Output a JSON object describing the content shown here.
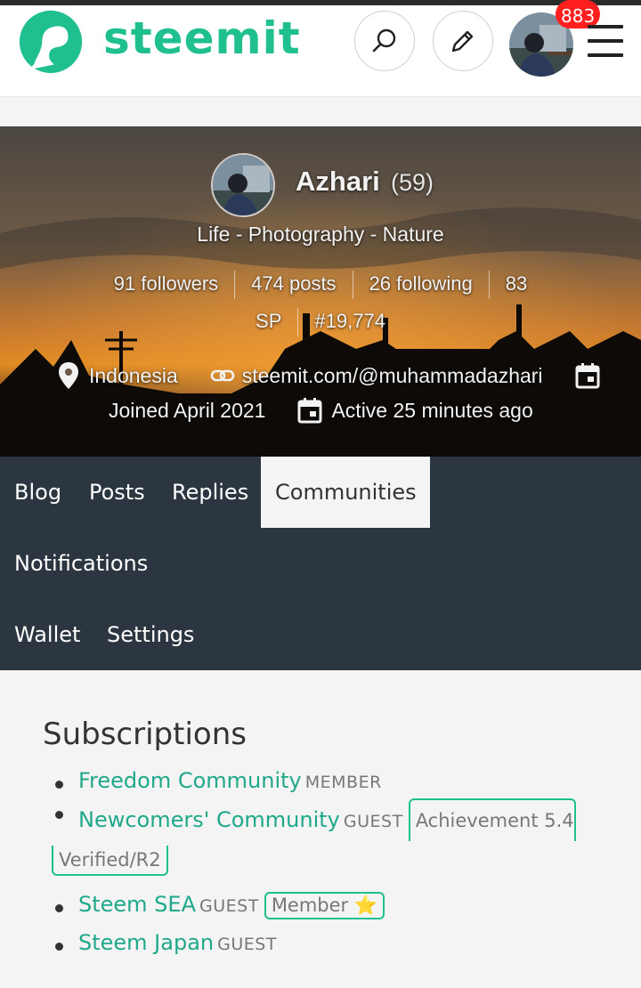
{
  "header": {
    "brand": "steemit",
    "notification_count": "883",
    "colors": {
      "brand": "#1fbf8f",
      "badge": "#ff1f1f"
    }
  },
  "profile": {
    "name": "Azhari",
    "reputation": "(59)",
    "about": "Life - Photography - Nature",
    "followers": "91 followers",
    "posts": "474 posts",
    "following": "26 following",
    "sp_value": "83",
    "sp_unit": "SP",
    "rank": "#19,774",
    "location": "Indonesia",
    "website": "steemit.com/@muhammadazhari",
    "joined": "Joined April 2021",
    "active": "Active 25 minutes ago"
  },
  "tabs": {
    "blog": "Blog",
    "posts": "Posts",
    "replies": "Replies",
    "communities": "Communities",
    "notifications": "Notifications",
    "wallet": "Wallet",
    "settings": "Settings",
    "active": "Communities"
  },
  "subscriptions": {
    "title": "Subscriptions",
    "items": [
      {
        "name": "Freedom Community",
        "role": "MEMBER",
        "badge": ""
      },
      {
        "name": "Newcomers' Community",
        "role": "GUEST",
        "badge": "Achievement 5.4",
        "badge_cont": "Verified/R2"
      },
      {
        "name": "Steem SEA",
        "role": "GUEST",
        "badge": "Member ⭐"
      },
      {
        "name": "Steem Japan",
        "role": "GUEST",
        "badge": ""
      }
    ]
  }
}
